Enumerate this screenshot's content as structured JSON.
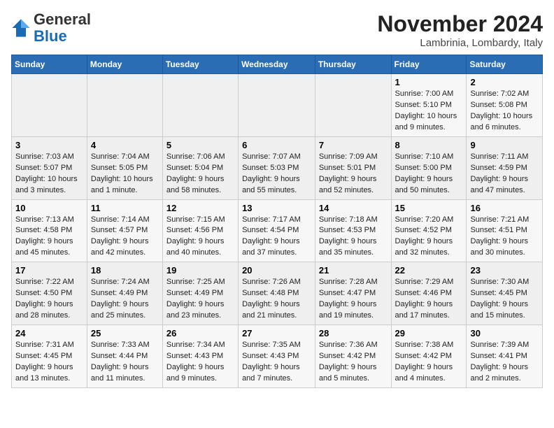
{
  "header": {
    "logo_general": "General",
    "logo_blue": "Blue",
    "month": "November 2024",
    "location": "Lambrinia, Lombardy, Italy"
  },
  "days_of_week": [
    "Sunday",
    "Monday",
    "Tuesday",
    "Wednesday",
    "Thursday",
    "Friday",
    "Saturday"
  ],
  "weeks": [
    [
      {
        "day": "",
        "info": ""
      },
      {
        "day": "",
        "info": ""
      },
      {
        "day": "",
        "info": ""
      },
      {
        "day": "",
        "info": ""
      },
      {
        "day": "",
        "info": ""
      },
      {
        "day": "1",
        "info": "Sunrise: 7:00 AM\nSunset: 5:10 PM\nDaylight: 10 hours and 9 minutes."
      },
      {
        "day": "2",
        "info": "Sunrise: 7:02 AM\nSunset: 5:08 PM\nDaylight: 10 hours and 6 minutes."
      }
    ],
    [
      {
        "day": "3",
        "info": "Sunrise: 7:03 AM\nSunset: 5:07 PM\nDaylight: 10 hours and 3 minutes."
      },
      {
        "day": "4",
        "info": "Sunrise: 7:04 AM\nSunset: 5:05 PM\nDaylight: 10 hours and 1 minute."
      },
      {
        "day": "5",
        "info": "Sunrise: 7:06 AM\nSunset: 5:04 PM\nDaylight: 9 hours and 58 minutes."
      },
      {
        "day": "6",
        "info": "Sunrise: 7:07 AM\nSunset: 5:03 PM\nDaylight: 9 hours and 55 minutes."
      },
      {
        "day": "7",
        "info": "Sunrise: 7:09 AM\nSunset: 5:01 PM\nDaylight: 9 hours and 52 minutes."
      },
      {
        "day": "8",
        "info": "Sunrise: 7:10 AM\nSunset: 5:00 PM\nDaylight: 9 hours and 50 minutes."
      },
      {
        "day": "9",
        "info": "Sunrise: 7:11 AM\nSunset: 4:59 PM\nDaylight: 9 hours and 47 minutes."
      }
    ],
    [
      {
        "day": "10",
        "info": "Sunrise: 7:13 AM\nSunset: 4:58 PM\nDaylight: 9 hours and 45 minutes."
      },
      {
        "day": "11",
        "info": "Sunrise: 7:14 AM\nSunset: 4:57 PM\nDaylight: 9 hours and 42 minutes."
      },
      {
        "day": "12",
        "info": "Sunrise: 7:15 AM\nSunset: 4:56 PM\nDaylight: 9 hours and 40 minutes."
      },
      {
        "day": "13",
        "info": "Sunrise: 7:17 AM\nSunset: 4:54 PM\nDaylight: 9 hours and 37 minutes."
      },
      {
        "day": "14",
        "info": "Sunrise: 7:18 AM\nSunset: 4:53 PM\nDaylight: 9 hours and 35 minutes."
      },
      {
        "day": "15",
        "info": "Sunrise: 7:20 AM\nSunset: 4:52 PM\nDaylight: 9 hours and 32 minutes."
      },
      {
        "day": "16",
        "info": "Sunrise: 7:21 AM\nSunset: 4:51 PM\nDaylight: 9 hours and 30 minutes."
      }
    ],
    [
      {
        "day": "17",
        "info": "Sunrise: 7:22 AM\nSunset: 4:50 PM\nDaylight: 9 hours and 28 minutes."
      },
      {
        "day": "18",
        "info": "Sunrise: 7:24 AM\nSunset: 4:49 PM\nDaylight: 9 hours and 25 minutes."
      },
      {
        "day": "19",
        "info": "Sunrise: 7:25 AM\nSunset: 4:49 PM\nDaylight: 9 hours and 23 minutes."
      },
      {
        "day": "20",
        "info": "Sunrise: 7:26 AM\nSunset: 4:48 PM\nDaylight: 9 hours and 21 minutes."
      },
      {
        "day": "21",
        "info": "Sunrise: 7:28 AM\nSunset: 4:47 PM\nDaylight: 9 hours and 19 minutes."
      },
      {
        "day": "22",
        "info": "Sunrise: 7:29 AM\nSunset: 4:46 PM\nDaylight: 9 hours and 17 minutes."
      },
      {
        "day": "23",
        "info": "Sunrise: 7:30 AM\nSunset: 4:45 PM\nDaylight: 9 hours and 15 minutes."
      }
    ],
    [
      {
        "day": "24",
        "info": "Sunrise: 7:31 AM\nSunset: 4:45 PM\nDaylight: 9 hours and 13 minutes."
      },
      {
        "day": "25",
        "info": "Sunrise: 7:33 AM\nSunset: 4:44 PM\nDaylight: 9 hours and 11 minutes."
      },
      {
        "day": "26",
        "info": "Sunrise: 7:34 AM\nSunset: 4:43 PM\nDaylight: 9 hours and 9 minutes."
      },
      {
        "day": "27",
        "info": "Sunrise: 7:35 AM\nSunset: 4:43 PM\nDaylight: 9 hours and 7 minutes."
      },
      {
        "day": "28",
        "info": "Sunrise: 7:36 AM\nSunset: 4:42 PM\nDaylight: 9 hours and 5 minutes."
      },
      {
        "day": "29",
        "info": "Sunrise: 7:38 AM\nSunset: 4:42 PM\nDaylight: 9 hours and 4 minutes."
      },
      {
        "day": "30",
        "info": "Sunrise: 7:39 AM\nSunset: 4:41 PM\nDaylight: 9 hours and 2 minutes."
      }
    ]
  ]
}
